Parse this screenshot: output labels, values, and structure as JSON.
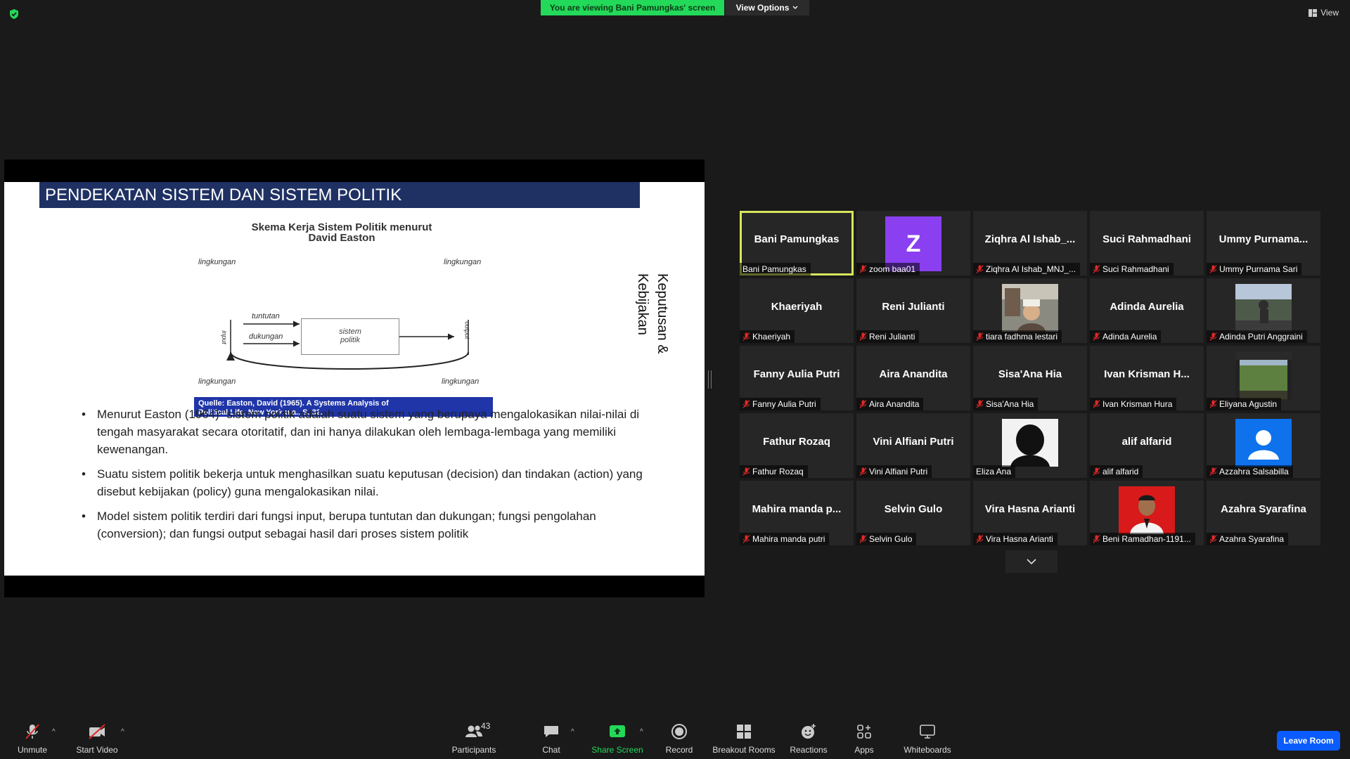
{
  "top": {
    "banner": "You are viewing Bani Pamungkas' screen",
    "view_options": "View Options",
    "view": "View"
  },
  "slide": {
    "title": "PENDEKATAN SISTEM DAN SISTEM POLITIK",
    "diagram": {
      "heading_line1": "Skema Kerja Sistem Politik menurut",
      "heading_line2": "David Easton",
      "lingkungan": "lingkungan",
      "tuntutan": "tuntutan",
      "dukungan": "dukungan",
      "input": "input",
      "output": "output",
      "box_line1": "sistem",
      "box_line2": "politik",
      "source_line1": "Quelle: Easton, David (1965). A Systems Analysis of",
      "source_line2": "Political Life, New York u.a., S. 32."
    },
    "vertical_text": "Keputusan &\nKebijakan",
    "bullets": [
      "Menurut Easton (1964) “sistem politik adalah suatu sistem yang berupaya mengalokasikan nilai-nilai di tengah masyarakat secara otoritatif, dan ini hanya dilakukan oleh lembaga-lembaga yang memiliki kewenangan.",
      "Suatu sistem politik bekerja untuk menghasilkan suatu keputusan (decision) dan tindakan (action) yang disebut kebijakan (policy) guna mengalokasikan nilai.",
      "Model sistem politik terdiri dari fungsi input, berupa tuntutan dan dukungan; fungsi pengolahan (conversion); dan fungsi output sebagai hasil dari proses sistem politik"
    ]
  },
  "gallery": {
    "tiles": [
      {
        "name": "Bani Pamungkas",
        "label": "Bani Pamungkas",
        "active": true,
        "muted": false
      },
      {
        "name": "",
        "label": "zoom baa01",
        "avatar": "Z",
        "muted": true
      },
      {
        "name": "Ziqhra Al Ishab_...",
        "label": "Ziqhra Al Ishab_MNJ_...",
        "muted": true
      },
      {
        "name": "Suci Rahmadhani",
        "label": "Suci Rahmadhani",
        "muted": true
      },
      {
        "name": "Ummy  Purnama...",
        "label": "Ummy Purnama Sari",
        "muted": true
      },
      {
        "name": "Khaeriyah",
        "label": "Khaeriyah",
        "muted": true
      },
      {
        "name": "Reni Julianti",
        "label": "Reni Julianti",
        "muted": true
      },
      {
        "name": "",
        "label": "tiara fadhma lestari",
        "video": "person-street",
        "muted": true
      },
      {
        "name": "Adinda Aurelia",
        "label": "Adinda Aurelia",
        "muted": true
      },
      {
        "name": "",
        "label": "Adinda Putri Anggraini",
        "video": "outdoor",
        "muted": true
      },
      {
        "name": "Fanny Aulia Putri",
        "label": "Fanny Aulia Putri",
        "muted": true
      },
      {
        "name": "Aira Anandita",
        "label": "Aira Anandita",
        "muted": true
      },
      {
        "name": "Sisa'Ana Hia",
        "label": "Sisa'Ana Hia",
        "muted": true
      },
      {
        "name": "Ivan Krisman H...",
        "label": "Ivan Krisman Hura",
        "muted": true
      },
      {
        "name": "",
        "label": "Eliyana Agustin",
        "video": "nature",
        "muted": true
      },
      {
        "name": "Fathur Rozaq",
        "label": "Fathur Rozaq",
        "muted": true
      },
      {
        "name": "Vini Alfiani Putri",
        "label": "Vini Alfiani Putri",
        "muted": true
      },
      {
        "name": "",
        "label": "Eliza Ana",
        "video": "silhouette",
        "muted": false
      },
      {
        "name": "alif alfarid",
        "label": "alif alfarid",
        "muted": true
      },
      {
        "name": "",
        "label": "Azzahra Salsabilla",
        "video": "default-avatar",
        "muted": true
      },
      {
        "name": "Mahira  manda p...",
        "label": "Mahira manda putri",
        "muted": true
      },
      {
        "name": "Selvin Gulo",
        "label": "Selvin Gulo",
        "muted": true
      },
      {
        "name": "Vira Hasna Arianti",
        "label": "Vira Hasna Arianti",
        "muted": true
      },
      {
        "name": "",
        "label": "Beni Ramadhan-1191...",
        "video": "portrait-red",
        "muted": true
      },
      {
        "name": "Azahra Syarafina",
        "label": "Azahra Syarafina",
        "muted": true
      }
    ]
  },
  "toolbar": {
    "unmute": "Unmute",
    "start_video": "Start Video",
    "participants": "Participants",
    "participants_count": "43",
    "chat": "Chat",
    "share_screen": "Share Screen",
    "record": "Record",
    "breakout_rooms": "Breakout Rooms",
    "reactions": "Reactions",
    "apps": "Apps",
    "whiteboards": "Whiteboards",
    "leave_room": "Leave Room"
  },
  "colors": {
    "banner_green": "#23d959",
    "slide_title_bg": "#1f3163",
    "source_bg": "#1f35a8",
    "active_border": "#d8e65a",
    "leave_blue": "#0b5cff",
    "mute_red": "#e02828",
    "avatar_purple": "#8a3ff0"
  }
}
